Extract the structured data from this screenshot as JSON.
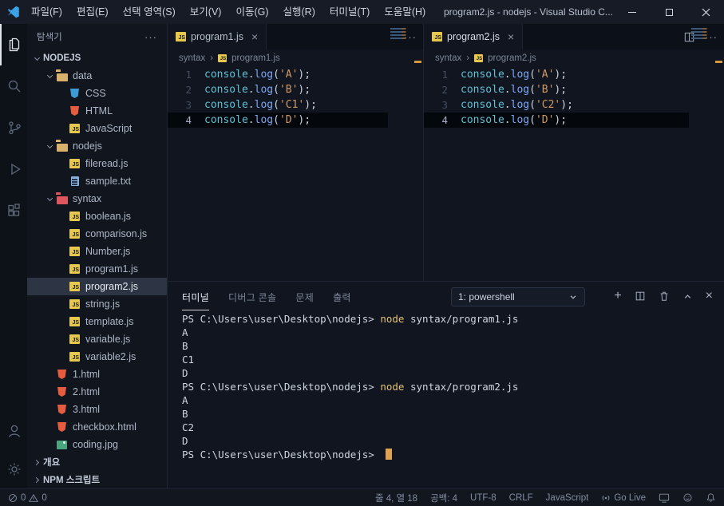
{
  "window": {
    "menus": [
      "파일(F)",
      "편집(E)",
      "선택 영역(S)",
      "보기(V)",
      "이동(G)",
      "실행(R)",
      "터미널(T)",
      "도움말(H)"
    ],
    "title": "program2.js - nodejs - Visual Studio C..."
  },
  "glyphs": {
    "more": "···",
    "tab_close": "×",
    "plus": "+",
    "panel_close": "×",
    "breadcrumb_sep": "›"
  },
  "activity_bar": {
    "top": [
      {
        "name": "explorer",
        "active": true
      },
      {
        "name": "search"
      },
      {
        "name": "source-control"
      },
      {
        "name": "run-debug"
      },
      {
        "name": "extensions"
      }
    ],
    "bottom": [
      {
        "name": "account"
      },
      {
        "name": "settings"
      }
    ]
  },
  "sidebar": {
    "header": "탐색기",
    "tree": [
      {
        "label": "NODEJS",
        "level": 0,
        "chevron": "down",
        "style": "root"
      },
      {
        "label": "data",
        "level": 1,
        "icon": "folder",
        "chevron": "down"
      },
      {
        "label": "CSS",
        "level": 2,
        "icon": "css"
      },
      {
        "label": "HTML",
        "level": 2,
        "icon": "html"
      },
      {
        "label": "JavaScript",
        "level": 2,
        "icon": "js"
      },
      {
        "label": "nodejs",
        "level": 1,
        "icon": "folder",
        "chevron": "down"
      },
      {
        "label": "fileread.js",
        "level": 2,
        "icon": "js"
      },
      {
        "label": "sample.txt",
        "level": 2,
        "icon": "txt"
      },
      {
        "label": "syntax",
        "level": 1,
        "icon": "folder-red",
        "chevron": "down"
      },
      {
        "label": "boolean.js",
        "level": 2,
        "icon": "js"
      },
      {
        "label": "comparison.js",
        "level": 2,
        "icon": "js"
      },
      {
        "label": "Number.js",
        "level": 2,
        "icon": "js"
      },
      {
        "label": "program1.js",
        "level": 2,
        "icon": "js"
      },
      {
        "label": "program2.js",
        "level": 2,
        "icon": "js",
        "selected": true
      },
      {
        "label": "string.js",
        "level": 2,
        "icon": "js"
      },
      {
        "label": "template.js",
        "level": 2,
        "icon": "js"
      },
      {
        "label": "variable.js",
        "level": 2,
        "icon": "js"
      },
      {
        "label": "variable2.js",
        "level": 2,
        "icon": "js"
      },
      {
        "label": "1.html",
        "level": 1,
        "icon": "html"
      },
      {
        "label": "2.html",
        "level": 1,
        "icon": "html"
      },
      {
        "label": "3.html",
        "level": 1,
        "icon": "html"
      },
      {
        "label": "checkbox.html",
        "level": 1,
        "icon": "html"
      },
      {
        "label": "coding.jpg",
        "level": 1,
        "icon": "img"
      },
      {
        "label": "개요",
        "level": 0,
        "chevron": "right",
        "style": "section"
      },
      {
        "label": "NPM 스크립트",
        "level": 0,
        "chevron": "right",
        "style": "section"
      }
    ]
  },
  "editors": [
    {
      "tab": {
        "label": "program1.js"
      },
      "breadcrumb": {
        "folder": "syntax",
        "file": "program1.js"
      },
      "current_line": 4,
      "code": [
        {
          "n": "1",
          "obj": "console",
          "dot": ".",
          "method": "log",
          "open": "(",
          "str": "'A'",
          "close": ");"
        },
        {
          "n": "2",
          "obj": "console",
          "dot": ".",
          "method": "log",
          "open": "(",
          "str": "'B'",
          "close": ");"
        },
        {
          "n": "3",
          "obj": "console",
          "dot": ".",
          "method": "log",
          "open": "(",
          "str": "'C1'",
          "close": ");"
        },
        {
          "n": "4",
          "obj": "console",
          "dot": ".",
          "method": "log",
          "open": "(",
          "str": "'D'",
          "close": ");"
        }
      ]
    },
    {
      "tab": {
        "label": "program2.js"
      },
      "breadcrumb": {
        "folder": "syntax",
        "file": "program2.js"
      },
      "current_line": 4,
      "code": [
        {
          "n": "1",
          "obj": "console",
          "dot": ".",
          "method": "log",
          "open": "(",
          "str": "'A'",
          "close": ");"
        },
        {
          "n": "2",
          "obj": "console",
          "dot": ".",
          "method": "log",
          "open": "(",
          "str": "'B'",
          "close": ");"
        },
        {
          "n": "3",
          "obj": "console",
          "dot": ".",
          "method": "log",
          "open": "(",
          "str": "'C2'",
          "close": ");"
        },
        {
          "n": "4",
          "obj": "console",
          "dot": ".",
          "method": "log",
          "open": "(",
          "str": "'D'",
          "close": ");"
        }
      ]
    }
  ],
  "panel": {
    "tabs": [
      {
        "label": "터미널",
        "active": true
      },
      {
        "label": "디버그 콘솔"
      },
      {
        "label": "문제"
      },
      {
        "label": "출력"
      }
    ],
    "shell_selector": "1: powershell",
    "terminal": {
      "prompt": "PS C:\\Users\\user\\Desktop\\nodejs>",
      "lines": [
        {
          "type": "command",
          "command": "node",
          "args": "syntax/program1.js"
        },
        {
          "type": "output",
          "text": "A"
        },
        {
          "type": "output",
          "text": "B"
        },
        {
          "type": "output",
          "text": "C1"
        },
        {
          "type": "output",
          "text": "D"
        },
        {
          "type": "command",
          "command": "node",
          "args": "syntax/program2.js"
        },
        {
          "type": "output",
          "text": "A"
        },
        {
          "type": "output",
          "text": "B"
        },
        {
          "type": "output",
          "text": "C2"
        },
        {
          "type": "output",
          "text": "D"
        },
        {
          "type": "prompt-cursor"
        }
      ]
    }
  },
  "status_bar": {
    "errors": "0",
    "warnings": "0",
    "items": [
      "줄 4, 열 18",
      "공백: 4",
      "UTF-8",
      "CRLF",
      "JavaScript"
    ],
    "go_live": "Go Live"
  },
  "colors": {
    "folder_yellow": "#d9b06c",
    "folder_red": "#e0565f",
    "js_badge": "#e6c84e",
    "html_orange": "#e65c41",
    "css_blue": "#3d9cd6",
    "txt_blue": "#86b0dd",
    "img_green": "#4aa57d",
    "token_object": "#61c0d4",
    "token_method": "#7fa7f5",
    "token_string": "#d29a66",
    "token_punct": "#ccd3df",
    "terminal_cmd": "#e3c078",
    "cursor_orange": "#e0a14c",
    "selected_row": "#2d3545",
    "current_line": "#04070c",
    "modified_marker": "#d7973c"
  }
}
